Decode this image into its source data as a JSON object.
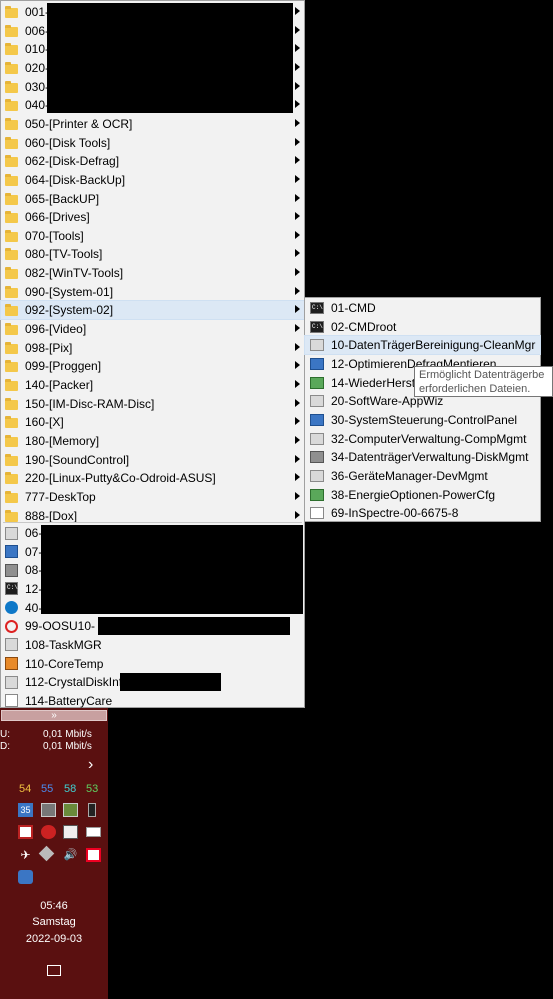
{
  "main_menu": {
    "items": [
      {
        "label": "001-",
        "icon": "folder-icon",
        "arrow": true
      },
      {
        "label": "006-",
        "icon": "folder-icon",
        "arrow": true
      },
      {
        "label": "010-",
        "icon": "folder-icon",
        "arrow": true
      },
      {
        "label": "020-",
        "icon": "folder-icon",
        "arrow": true
      },
      {
        "label": "030-",
        "icon": "folder-icon",
        "arrow": true
      },
      {
        "label": "040-",
        "icon": "folder-icon",
        "arrow": true
      },
      {
        "label": "050-[Printer & OCR]",
        "icon": "folder-icon",
        "arrow": true
      },
      {
        "label": "060-[Disk Tools]",
        "icon": "folder-icon",
        "arrow": true
      },
      {
        "label": "062-[Disk-Defrag]",
        "icon": "folder-icon",
        "arrow": true
      },
      {
        "label": "064-[Disk-BackUp]",
        "icon": "folder-icon",
        "arrow": true
      },
      {
        "label": "065-[BackUP]",
        "icon": "folder-icon",
        "arrow": true
      },
      {
        "label": "066-[Drives]",
        "icon": "folder-icon",
        "arrow": true
      },
      {
        "label": "070-[Tools]",
        "icon": "folder-icon",
        "arrow": true
      },
      {
        "label": "080-[TV-Tools]",
        "icon": "folder-icon",
        "arrow": true
      },
      {
        "label": "082-[WinTV-Tools]",
        "icon": "folder-icon",
        "arrow": true
      },
      {
        "label": "090-[System-01]",
        "icon": "folder-icon",
        "arrow": true
      },
      {
        "label": "092-[System-02]",
        "icon": "folder-icon",
        "arrow": true
      },
      {
        "label": "096-[Video]",
        "icon": "folder-icon",
        "arrow": true
      },
      {
        "label": "098-[Pix]",
        "icon": "folder-icon",
        "arrow": true
      },
      {
        "label": "099-[Proggen]",
        "icon": "folder-icon",
        "arrow": true
      },
      {
        "label": "140-[Packer]",
        "icon": "folder-icon",
        "arrow": true
      },
      {
        "label": "150-[IM-Disc-RAM-Disc]",
        "icon": "folder-icon",
        "arrow": true
      },
      {
        "label": "160-[X]",
        "icon": "folder-icon",
        "arrow": true
      },
      {
        "label": "180-[Memory]",
        "icon": "folder-icon",
        "arrow": true
      },
      {
        "label": "190-[SoundControl]",
        "icon": "folder-icon",
        "arrow": true
      },
      {
        "label": "220-[Linux-Putty&Co-Odroid-ASUS]",
        "icon": "folder-icon",
        "arrow": true
      },
      {
        "label": "777-DeskTop",
        "icon": "folder-icon",
        "arrow": true
      },
      {
        "label": "888-[Dox]",
        "icon": "folder-icon",
        "arrow": true
      },
      {
        "label": "06-",
        "icon": "app-generic-icon",
        "arrow": false
      },
      {
        "label": "07-",
        "icon": "app-window-icon",
        "arrow": false
      },
      {
        "label": "08-",
        "icon": "app-dark-icon",
        "arrow": false
      },
      {
        "label": "12-",
        "icon": "cmd-icon",
        "arrow": false
      },
      {
        "label": "40-",
        "icon": "teamviewer-icon",
        "arrow": false
      },
      {
        "label": "99-OOSU10-",
        "icon": "prohibited-icon",
        "arrow": false
      },
      {
        "label": "108-TaskMGR",
        "icon": "task-manager-icon",
        "arrow": false
      },
      {
        "label": "110-CoreTemp",
        "icon": "coretemp-icon",
        "arrow": false
      },
      {
        "label": "112-CrystalDiskInfo",
        "icon": "crystaldisk-icon",
        "arrow": false
      },
      {
        "label": "114-BatteryCare",
        "icon": "document-icon",
        "arrow": false
      }
    ],
    "highlighted": "092-[System-02]"
  },
  "submenu": {
    "items": [
      {
        "label": "01-CMD",
        "icon": "cmd-icon"
      },
      {
        "label": "02-CMDroot",
        "icon": "cmd-icon"
      },
      {
        "label": "10-DatenTrägerBereinigung-CleanMgr",
        "icon": "disk-cleanup-icon"
      },
      {
        "label": "12-OptimierenDefragMentieren",
        "icon": "defrag-icon"
      },
      {
        "label": "14-WiederHerstel",
        "icon": "restore-icon"
      },
      {
        "label": "20-SoftWare-AppWiz",
        "icon": "programs-icon"
      },
      {
        "label": "30-SystemSteuerung-ControlPanel",
        "icon": "control-panel-icon"
      },
      {
        "label": "32-ComputerVerwaltung-CompMgmt",
        "icon": "computer-management-icon"
      },
      {
        "label": "34-DatenträgerVerwaltung-DiskMgmt",
        "icon": "disk-management-icon"
      },
      {
        "label": "36-GeräteManager-DevMgmt",
        "icon": "device-manager-icon"
      },
      {
        "label": "38-EnergieOptionen-PowerCfg",
        "icon": "power-options-icon"
      },
      {
        "label": "69-InSpectre-00-6675-8",
        "icon": "inspectre-icon"
      }
    ],
    "highlighted": "10-DatenTrägerBereinigung-CleanMgr"
  },
  "tooltip": {
    "line1": "Ermöglicht Datenträgerbe",
    "line2": "erforderlichen Dateien."
  },
  "taskbar": {
    "expand_label": "»",
    "upload_label": "U:",
    "upload_value": "0,01 Mbit/s",
    "download_label": "D:",
    "download_value": "0,01 Mbit/s",
    "next_glyph": "›",
    "temps": [
      {
        "value": "54",
        "color": "#f0c040"
      },
      {
        "value": "55",
        "color": "#4a8cf0"
      },
      {
        "value": "58",
        "color": "#40d0d0"
      },
      {
        "value": "53",
        "color": "#60d060"
      }
    ],
    "clock_time": "05:46",
    "clock_day": "Samstag",
    "clock_date": "2022-09-03"
  }
}
